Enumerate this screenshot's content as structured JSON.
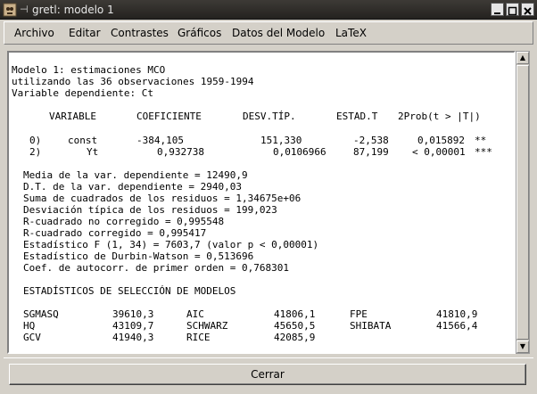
{
  "window": {
    "title": "gretl: modelo 1"
  },
  "menu": [
    {
      "label": "Archivo"
    },
    {
      "label": "Editar"
    },
    {
      "label": "Contrastes"
    },
    {
      "label": "Gráficos"
    },
    {
      "label": "Datos del Modelo"
    },
    {
      "label": "LaTeX"
    }
  ],
  "output": {
    "header": [
      "Modelo 1: estimaciones MCO",
      "utilizando las 36 observaciones 1959-1994",
      "Variable dependiente: Ct"
    ],
    "columns": {
      "variable": "VARIABLE",
      "coef": "COEFICIENTE",
      "se": "DESV.TÍP.",
      "t": "ESTAD.T",
      "p": "2Prob(t > |T|)"
    },
    "rows": [
      {
        "idx": "0)",
        "var": "const",
        "coef": "-384,105",
        "se": "151,330",
        "t": "-2,538",
        "p": "0,015892",
        "stars": "**"
      },
      {
        "idx": "2)",
        "var": "Yt",
        "coef": "0,932738",
        "se": "0,0106966",
        "t": "87,199",
        "p": "< 0,00001",
        "stars": "***"
      }
    ],
    "stats": [
      "Media de la var. dependiente = 12490,9",
      "D.T. de la var. dependiente = 2940,03",
      "Suma de cuadrados de los residuos = 1,34675e+06",
      "Desviación típica de los residuos = 199,023",
      "R-cuadrado no corregido = 0,995548",
      "R-cuadrado corregido = 0,995417",
      "Estadístico F (1, 34) = 7603,7 (valor p < 0,00001)",
      "Estadístico de Durbin-Watson = 0,513696",
      "Coef. de autocorr. de primer orden = 0,768301"
    ],
    "selection_title": "ESTADÍSTICOS DE SELECCIÓN DE MODELOS",
    "selection": [
      [
        "SGMASQ",
        "39610,3",
        "AIC",
        "41806,1",
        "FPE",
        "41810,9"
      ],
      [
        "HQ",
        "43109,7",
        "SCHWARZ",
        "45650,5",
        "SHIBATA",
        "41566,4"
      ],
      [
        "GCV",
        "41940,3",
        "RICE",
        "42085,9",
        "",
        ""
      ]
    ]
  },
  "buttons": {
    "close": "Cerrar"
  }
}
